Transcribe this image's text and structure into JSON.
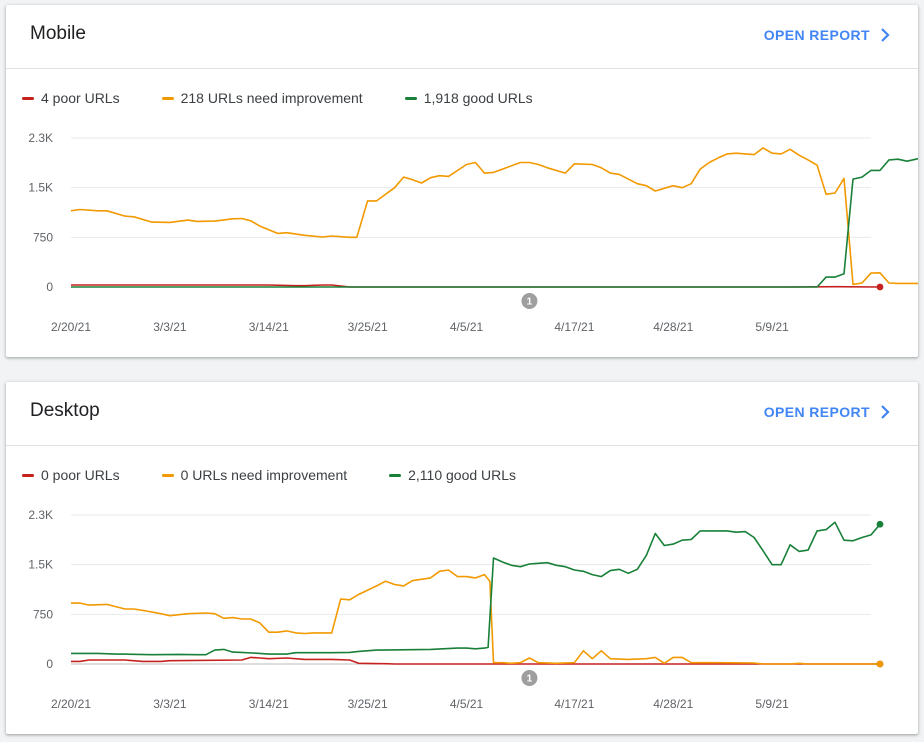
{
  "cards": [
    {
      "title": "Mobile",
      "open_report_label": "OPEN REPORT",
      "legend": [
        {
          "label": "4 poor URLs",
          "color": "#c5221f"
        },
        {
          "label": "218 URLs need improvement",
          "color": "#f29900"
        },
        {
          "label": "1,918 good URLs",
          "color": "#188038"
        }
      ],
      "annotation": "1"
    },
    {
      "title": "Desktop",
      "open_report_label": "OPEN REPORT",
      "legend": [
        {
          "label": "0 poor URLs",
          "color": "#c5221f"
        },
        {
          "label": "0 URLs need improvement",
          "color": "#f29900"
        },
        {
          "label": "2,110 good URLs",
          "color": "#188038"
        }
      ],
      "annotation": "1"
    }
  ],
  "chart_data": [
    {
      "type": "line",
      "chart": "Mobile",
      "x_start": "2/20/21",
      "x_end": "5/20/21",
      "xticks": [
        "2/20/21",
        "3/3/21",
        "3/14/21",
        "3/25/21",
        "4/5/21",
        "4/17/21",
        "4/28/21",
        "5/9/21"
      ],
      "yticks": [
        "0",
        "750",
        "1.5K",
        "2.3K"
      ],
      "ylim": [
        0,
        2250
      ],
      "grid": true,
      "annotation_date": "4/12/21",
      "series": [
        {
          "name": "Poor",
          "color": "#c5221f",
          "values": [
            [
              0,
              30
            ],
            [
              10,
              30
            ],
            [
              20,
              30
            ],
            [
              22,
              30
            ],
            [
              25,
              20
            ],
            [
              26,
              20
            ],
            [
              28,
              30
            ],
            [
              29,
              30
            ],
            [
              31,
              0
            ],
            [
              80,
              0
            ],
            [
              85,
              5
            ],
            [
              90,
              0
            ]
          ]
        },
        {
          "name": "Need improvement",
          "color": "#f29900",
          "values": [
            [
              0,
              1150
            ],
            [
              1,
              1170
            ],
            [
              3,
              1150
            ],
            [
              4,
              1150
            ],
            [
              6,
              1070
            ],
            [
              7,
              1060
            ],
            [
              9,
              980
            ],
            [
              11,
              975
            ],
            [
              13,
              1010
            ],
            [
              14,
              990
            ],
            [
              16,
              995
            ],
            [
              18,
              1030
            ],
            [
              19,
              1035
            ],
            [
              20,
              1000
            ],
            [
              21,
              920
            ],
            [
              23,
              810
            ],
            [
              24,
              820
            ],
            [
              26,
              780
            ],
            [
              28,
              755
            ],
            [
              29,
              770
            ],
            [
              31,
              750
            ],
            [
              31.8,
              750
            ],
            [
              33,
              1300
            ],
            [
              34,
              1300
            ],
            [
              36,
              1500
            ],
            [
              37,
              1660
            ],
            [
              38,
              1620
            ],
            [
              39,
              1570
            ],
            [
              40,
              1650
            ],
            [
              41,
              1680
            ],
            [
              42,
              1670
            ],
            [
              44,
              1850
            ],
            [
              45,
              1880
            ],
            [
              46,
              1720
            ],
            [
              47,
              1730
            ],
            [
              48,
              1780
            ],
            [
              50,
              1880
            ],
            [
              51,
              1880
            ],
            [
              52,
              1850
            ],
            [
              53,
              1800
            ],
            [
              55,
              1720
            ],
            [
              56,
              1860
            ],
            [
              58,
              1850
            ],
            [
              59,
              1800
            ],
            [
              60,
              1720
            ],
            [
              61,
              1700
            ],
            [
              63,
              1560
            ],
            [
              64,
              1530
            ],
            [
              65,
              1450
            ],
            [
              66,
              1490
            ],
            [
              67,
              1530
            ],
            [
              68,
              1500
            ],
            [
              69,
              1560
            ],
            [
              70,
              1780
            ],
            [
              71,
              1880
            ],
            [
              72,
              1950
            ],
            [
              73,
              2010
            ],
            [
              74,
              2020
            ],
            [
              75,
              2010
            ],
            [
              76,
              2000
            ],
            [
              77,
              2100
            ],
            [
              78,
              2020
            ],
            [
              79,
              2010
            ],
            [
              80,
              2080
            ],
            [
              81,
              1990
            ],
            [
              82,
              1920
            ],
            [
              83,
              1840
            ],
            [
              84,
              1400
            ],
            [
              85,
              1420
            ],
            [
              86,
              1640
            ],
            [
              87,
              40
            ],
            [
              88,
              60
            ],
            [
              89,
              210
            ],
            [
              90,
              215
            ],
            [
              91,
              60
            ],
            [
              92,
              55
            ],
            [
              94,
              55
            ],
            [
              95,
              50
            ],
            [
              96,
              170
            ],
            [
              97,
              218
            ]
          ]
        },
        {
          "name": "Good",
          "color": "#188038",
          "values": [
            [
              0,
              0
            ],
            [
              83,
              0
            ],
            [
              84,
              150
            ],
            [
              85,
              150
            ],
            [
              86,
              200
            ],
            [
              87,
              1630
            ],
            [
              88,
              1660
            ],
            [
              89,
              1760
            ],
            [
              90,
              1760
            ],
            [
              91,
              1920
            ],
            [
              92,
              1930
            ],
            [
              93,
              1900
            ],
            [
              94,
              1930
            ],
            [
              95,
              1960
            ],
            [
              96,
              1918
            ]
          ]
        }
      ]
    },
    {
      "type": "line",
      "chart": "Desktop",
      "x_start": "2/20/21",
      "x_end": "5/20/21",
      "xticks": [
        "2/20/21",
        "3/3/21",
        "3/14/21",
        "3/25/21",
        "4/5/21",
        "4/17/21",
        "4/28/21",
        "5/9/21"
      ],
      "yticks": [
        "0",
        "750",
        "1.5K",
        "2.3K"
      ],
      "ylim": [
        0,
        2250
      ],
      "grid": true,
      "annotation_date": "4/12/21",
      "series": [
        {
          "name": "Poor",
          "color": "#c5221f",
          "values": [
            [
              0,
              40
            ],
            [
              1,
              40
            ],
            [
              2,
              60
            ],
            [
              6,
              60
            ],
            [
              8,
              40
            ],
            [
              10,
              40
            ],
            [
              11,
              50
            ],
            [
              19,
              60
            ],
            [
              20,
              100
            ],
            [
              21,
              90
            ],
            [
              22,
              80
            ],
            [
              24,
              90
            ],
            [
              26,
              70
            ],
            [
              29,
              70
            ],
            [
              31,
              60
            ],
            [
              32,
              10
            ],
            [
              35,
              5
            ],
            [
              36,
              0
            ],
            [
              90,
              0
            ]
          ]
        },
        {
          "name": "Need improvement",
          "color": "#f29900",
          "values": [
            [
              0,
              920
            ],
            [
              1,
              920
            ],
            [
              2,
              890
            ],
            [
              4,
              900
            ],
            [
              6,
              830
            ],
            [
              7,
              830
            ],
            [
              8,
              810
            ],
            [
              10,
              760
            ],
            [
              11,
              730
            ],
            [
              13,
              760
            ],
            [
              15,
              770
            ],
            [
              16,
              760
            ],
            [
              17,
              690
            ],
            [
              18,
              700
            ],
            [
              19,
              680
            ],
            [
              20,
              680
            ],
            [
              21,
              620
            ],
            [
              22,
              480
            ],
            [
              23,
              480
            ],
            [
              24,
              500
            ],
            [
              25,
              470
            ],
            [
              26,
              460
            ],
            [
              27,
              470
            ],
            [
              28,
              470
            ],
            [
              29,
              470
            ],
            [
              30,
              980
            ],
            [
              31,
              970
            ],
            [
              32,
              1050
            ],
            [
              34,
              1180
            ],
            [
              35,
              1250
            ],
            [
              36,
              1200
            ],
            [
              37,
              1180
            ],
            [
              38,
              1260
            ],
            [
              40,
              1300
            ],
            [
              41,
              1400
            ],
            [
              42,
              1420
            ],
            [
              43,
              1320
            ],
            [
              44,
              1320
            ],
            [
              45,
              1300
            ],
            [
              46,
              1350
            ],
            [
              46.6,
              1250
            ],
            [
              47,
              20
            ],
            [
              48,
              20
            ],
            [
              49,
              10
            ],
            [
              50,
              20
            ],
            [
              51,
              90
            ],
            [
              52,
              20
            ],
            [
              54,
              10
            ],
            [
              56,
              20
            ],
            [
              57,
              200
            ],
            [
              58,
              80
            ],
            [
              59,
              200
            ],
            [
              60,
              80
            ],
            [
              62,
              70
            ],
            [
              64,
              80
            ],
            [
              65,
              100
            ],
            [
              66,
              10
            ],
            [
              67,
              100
            ],
            [
              68,
              100
            ],
            [
              69,
              20
            ],
            [
              72,
              20
            ],
            [
              76,
              15
            ],
            [
              77,
              0
            ],
            [
              80,
              0
            ],
            [
              81,
              10
            ],
            [
              82,
              0
            ],
            [
              90,
              0
            ]
          ]
        },
        {
          "name": "Good",
          "color": "#188038",
          "values": [
            [
              0,
              160
            ],
            [
              3,
              160
            ],
            [
              5,
              150
            ],
            [
              6,
              150
            ],
            [
              9,
              140
            ],
            [
              12,
              145
            ],
            [
              14,
              140
            ],
            [
              15,
              140
            ],
            [
              16,
              210
            ],
            [
              17,
              220
            ],
            [
              18,
              180
            ],
            [
              19,
              175
            ],
            [
              21,
              160
            ],
            [
              22,
              150
            ],
            [
              23,
              150
            ],
            [
              24,
              150
            ],
            [
              25,
              170
            ],
            [
              29,
              170
            ],
            [
              31,
              175
            ],
            [
              32,
              190
            ],
            [
              34,
              210
            ],
            [
              40,
              220
            ],
            [
              43,
              240
            ],
            [
              44,
              240
            ],
            [
              45,
              230
            ],
            [
              46,
              240
            ],
            [
              46.4,
              250
            ],
            [
              47,
              1600
            ],
            [
              48,
              1540
            ],
            [
              49,
              1490
            ],
            [
              50,
              1470
            ],
            [
              51,
              1510
            ],
            [
              52,
              1520
            ],
            [
              53,
              1530
            ],
            [
              54,
              1490
            ],
            [
              55,
              1470
            ],
            [
              56,
              1420
            ],
            [
              57,
              1400
            ],
            [
              58,
              1350
            ],
            [
              59,
              1320
            ],
            [
              60,
              1410
            ],
            [
              61,
              1430
            ],
            [
              62,
              1370
            ],
            [
              63,
              1430
            ],
            [
              64,
              1640
            ],
            [
              65,
              1970
            ],
            [
              66,
              1790
            ],
            [
              67,
              1810
            ],
            [
              68,
              1870
            ],
            [
              69,
              1880
            ],
            [
              70,
              2010
            ],
            [
              73,
              2010
            ],
            [
              74,
              1990
            ],
            [
              75,
              2000
            ],
            [
              76,
              1910
            ],
            [
              77,
              1710
            ],
            [
              78,
              1500
            ],
            [
              79,
              1500
            ],
            [
              80,
              1800
            ],
            [
              81,
              1700
            ],
            [
              82,
              1720
            ],
            [
              83,
              2010
            ],
            [
              84,
              2030
            ],
            [
              85,
              2140
            ],
            [
              86,
              1870
            ],
            [
              87,
              1860
            ],
            [
              88,
              1910
            ],
            [
              89,
              1950
            ],
            [
              90,
              2110
            ]
          ]
        }
      ]
    }
  ]
}
